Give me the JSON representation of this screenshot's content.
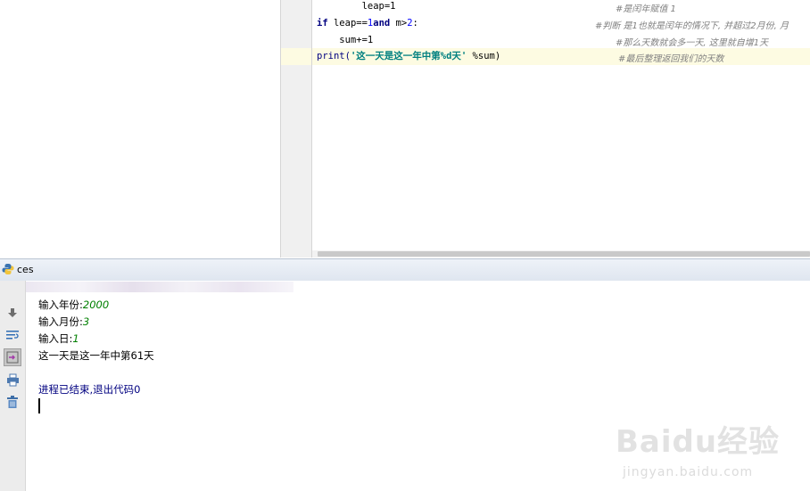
{
  "editor": {
    "lines": [
      {
        "code_prefix": "        leap=1",
        "comment": "#是闰年赋值 1"
      },
      {
        "kw1": "if",
        "mid1": " leap==",
        "num1": "1",
        "kw2": "and",
        "mid2": " m>",
        "num2": "2",
        "end": ":",
        "comment": "#判断 是1也就是闰年的情况下, 并超过2月份, 月"
      },
      {
        "code_prefix": "    sum+=1",
        "comment": "#那么天数就会多一天, 这里就自增1天"
      },
      {
        "fn": "print(",
        "str": "'这一天是这一年中第%d天'",
        "rest": " %sum)",
        "comment": "#最后整理返回我们的天数"
      }
    ]
  },
  "run_panel": {
    "title": "ces",
    "console": {
      "prompt_year": "输入年份:",
      "value_year": "2000",
      "prompt_month": "输入月份:",
      "value_month": "3",
      "prompt_day": "输入日:",
      "value_day": "1",
      "result": "这一天是这一年中第61天",
      "exit_text": "进程已结束,退出代码",
      "exit_code": "0"
    }
  },
  "watermark": {
    "logo": "Baidu经验",
    "url": "jingyan.baidu.com"
  },
  "colors": {
    "keyword": "#000080",
    "string": "#008080",
    "comment": "#808080",
    "input_value": "#008000",
    "current_line": "#fdfbe2"
  }
}
